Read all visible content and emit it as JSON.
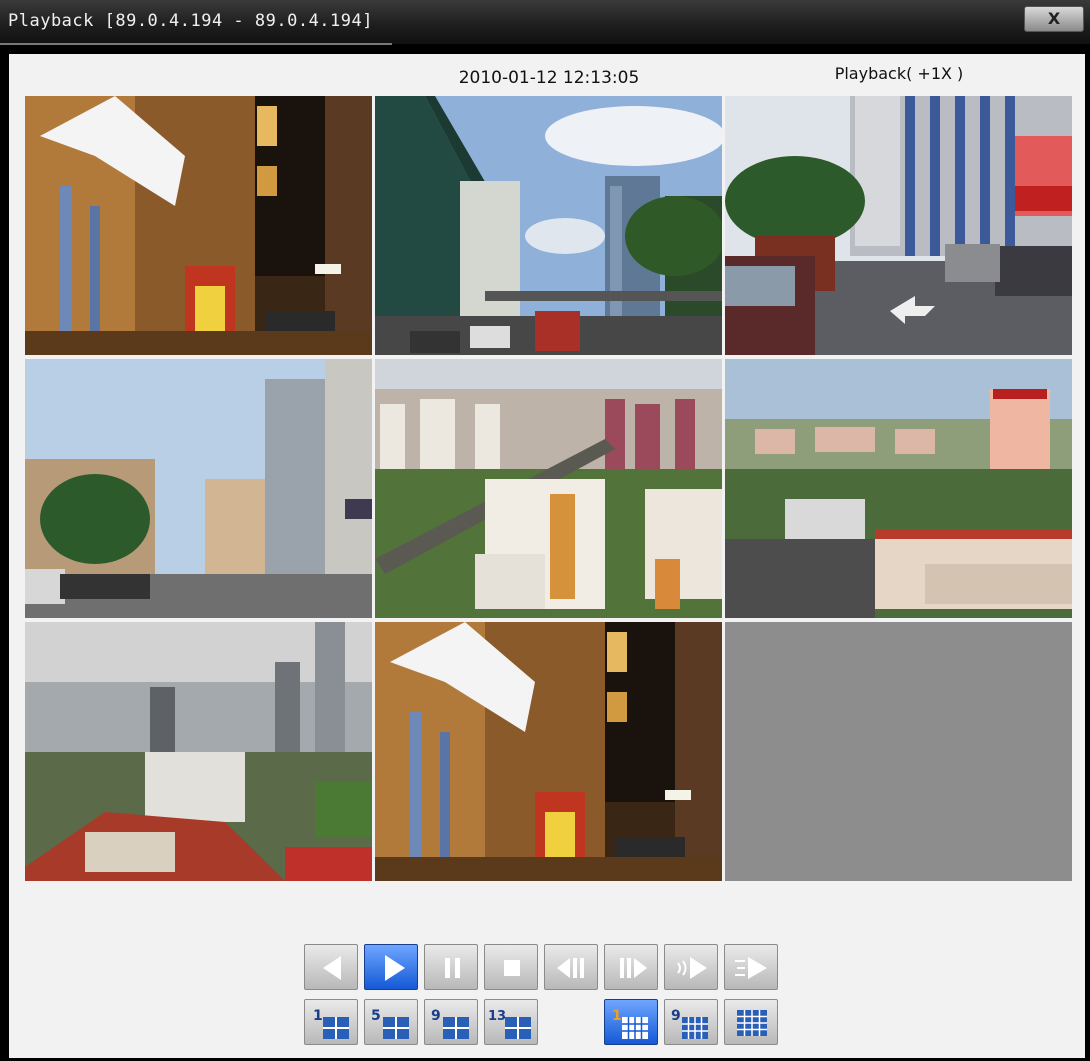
{
  "window": {
    "title": "Playback [89.0.4.194 - 89.0.4.194]",
    "close_label": "X"
  },
  "status": {
    "datetime": "2010-01-12 12:13:05",
    "playback_mode": "Playback( +1X )"
  },
  "cameras": [
    {
      "id": 1,
      "scene": "night-street-sign"
    },
    {
      "id": 2,
      "scene": "street-towers-day"
    },
    {
      "id": 3,
      "scene": "parked-cars-street"
    },
    {
      "id": 4,
      "scene": "shophouse-street"
    },
    {
      "id": 5,
      "scene": "aerial-flats-railway"
    },
    {
      "id": 6,
      "scene": "aerial-housing-estate"
    },
    {
      "id": 7,
      "scene": "aerial-city-skyline"
    },
    {
      "id": 8,
      "scene": "night-street-sign"
    },
    {
      "id": 9,
      "scene": "empty"
    }
  ],
  "playback_controls": [
    {
      "name": "reverse-play",
      "icon": "reverse-play-icon",
      "active": false
    },
    {
      "name": "play",
      "icon": "play-icon",
      "active": true
    },
    {
      "name": "pause",
      "icon": "pause-icon",
      "active": false
    },
    {
      "name": "stop",
      "icon": "stop-icon",
      "active": false
    },
    {
      "name": "step-back",
      "icon": "step-back-icon",
      "active": false
    },
    {
      "name": "step-forward",
      "icon": "step-forward-icon",
      "active": false
    },
    {
      "name": "slow-play",
      "icon": "slow-play-icon",
      "active": false
    },
    {
      "name": "fast-play",
      "icon": "fast-play-icon",
      "active": false
    }
  ],
  "layout_controls": [
    {
      "name": "layout-1",
      "label": "1",
      "active": false
    },
    {
      "name": "layout-5",
      "label": "5",
      "active": false
    },
    {
      "name": "layout-9",
      "label": "9",
      "active": false
    },
    {
      "name": "layout-13",
      "label": "13",
      "active": false
    },
    {
      "name": "view-1",
      "label": "1",
      "active": true
    },
    {
      "name": "view-9",
      "label": "9",
      "active": false
    },
    {
      "name": "view-16",
      "label": "",
      "active": false
    }
  ],
  "colors": {
    "accent_active": "#1559d6",
    "label_orange": "#f0a020",
    "empty_tile": "#8d8d8d"
  }
}
